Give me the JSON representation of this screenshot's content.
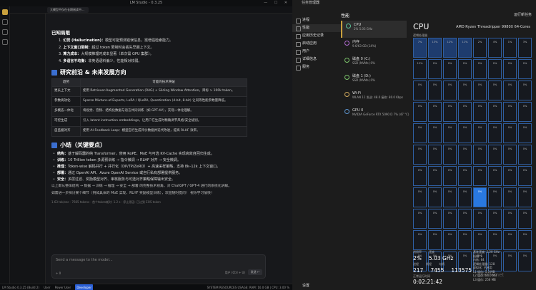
{
  "lm": {
    "title": "LM Studio - 0.3.25",
    "window_controls": "— ☐ ✕",
    "tab": "大模型不仅在长期阅读中...",
    "h_limits": "已知局限",
    "limits": [
      {
        "label": "幻觉 (Hallucination)：",
        "text": "模型可能预测错误信息，需增强检索能力。"
      },
      {
        "label": "上下文窗口限制：",
        "text": "超过 token 限制时会丢失早期上下文。"
      },
      {
        "label": "算力成本：",
        "text": "大规模推理时成本显著（单次需 GPU 集群）。"
      },
      {
        "label": "多语言不均衡：",
        "text": "非英语语料偏少，性能相对较弱。"
      }
    ],
    "h_research": "研究前沿 & 未来发展方向",
    "table_headers": [
      "趋势",
      "可能的技术突破"
    ],
    "table_rows": [
      {
        "k": "更长上下文",
        "v": "使用 Retriever-Augmented Generation (RAG) + Sliding Window Attention，目标 > 100k token。"
      },
      {
        "k": "参数高效化",
        "v": "Sparse Mixture-of-Experts, LoRA / QLoRA, Quantization (4-bit, 8-bit) 让同等性能参数量降低。"
      },
      {
        "k": "多模态一体化",
        "v": "将视觉、音频、结构化数据与语言共同训练（如 GPT-4V），实现一体化理解。"
      },
      {
        "k": "可控生成",
        "v": "引入 latent instruction embeddings，让用户在生成时精确调节风格/安全级别。"
      },
      {
        "k": "自监督对齐",
        "v": "使用 AI-Feedback Loop：模型自行生成评价数据并迭代改进，提高 RLHF 效率。"
      }
    ],
    "h_summary": "小结（关键要点）",
    "summary": [
      {
        "label": "结构：",
        "text": "基于解码器的纯 Transformer，使用 RoPE、MoE 与可选 KV-Cache 实现高效自回归生成。"
      },
      {
        "label": "训练：",
        "text": "10 Trillion token 多源预训练 → 指令微调 → RLHF 对齐 → 安全微调。"
      },
      {
        "label": "推理：",
        "text": "Token-wise 解码并行 + 并行化（DP/TP/ZeRO）+ 高速采样策略，支持 8k–12k 上下文窗口。"
      },
      {
        "label": "部署：",
        "text": "通过 OpenAI API、Azure OpenAI Service 或自行私有部署提供服务。"
      },
      {
        "label": "安全：",
        "text": "多层过滤、奖励模型对齐、审核服务与可选对齐策略保障输出安全。"
      }
    ],
    "note1": "以上即从整体结构 → 数据 → 训练 → 推理 → 安全 → 部署 的完整技术视角，对 ChatGPT / GPT-4 进行的系统化讲解。",
    "note2": "如需进一步探讨某个细节（例如具体的 MoE 实现、RLHF 奖励模型训练），欢迎随时提问！ 祝你学习愉快！",
    "stats": "1.63 tok/sec · 7665 tokens · 首个token耗时: 1.2 s · 停止原因: 已达到 EOS token",
    "input_placeholder": "Send a message to the model...",
    "input_count": "+ 0",
    "user_label": "用户 (Ctrl + U)",
    "send_label": "发送 ↵",
    "status": [
      "LM Studio 0.3.25 (Build 2)",
      "User",
      "Power User",
      "Developer",
      "SYSTEM RESOURCES USAGE: RAM: 16.0 GB | CPU: 3.00 %"
    ]
  },
  "tm": {
    "title": "任务管理器",
    "nav": [
      "进程",
      "性能",
      "应用历史记录",
      "启动应用",
      "用户",
      "详细信息",
      "服务"
    ],
    "header": "性能",
    "run_task": "运行新任务",
    "devices": [
      {
        "name": "CPU",
        "sub": "2%  5.03 GHz",
        "color": "#5cc49a"
      },
      {
        "name": "内存",
        "sub": "9.6/63 GB (14%)",
        "color": "#b06ad0"
      },
      {
        "name": "磁盘 0 (C:)",
        "sub": "SSD (NVMe)\n0%",
        "color": "#7cc36b"
      },
      {
        "name": "磁盘 1 (D:)",
        "sub": "SSD (NVMe)\n0%",
        "color": "#7cc36b"
      },
      {
        "name": "Wi-Fi",
        "sub": "WLAN 11\n发送: 48.0 接收: 80.0 Kbps",
        "color": "#d0a85c"
      },
      {
        "name": "GPU 0",
        "sub": "NVIDIA GeForce RTX 5090 D\n7% (47 °C)",
        "color": "#5c95d0"
      }
    ],
    "cpu_title": "CPU",
    "cpu_model": "AMD Ryzen Threadripper 9980X 64-Cores",
    "cpu_sub": "逻辑处理器",
    "cores": [
      "7%",
      "13%",
      "12%",
      "11%",
      "2%",
      "4%",
      "1%",
      "3%",
      "12%",
      "0%",
      "0%",
      "0%",
      "0%",
      "0%",
      "0%",
      "0%",
      "0%",
      "0%",
      "0%",
      "0%",
      "0%",
      "0%",
      "0%",
      "0%",
      "0%",
      "0%",
      "0%",
      "0%",
      "0%",
      "0%",
      "0%",
      "0%",
      "0%",
      "0%",
      "0%",
      "0%",
      "0%",
      "0%",
      "0%",
      "0%",
      "0%",
      "0%",
      "0%",
      "0%",
      "0%",
      "0%",
      "0%",
      "0%",
      "0%",
      "0%",
      "0%",
      "0%",
      "0%",
      "0%",
      "0%",
      "0%",
      "0%",
      "0%",
      "0%",
      "0%",
      "0%",
      "0%",
      "0%",
      "0%",
      "0%",
      "0%",
      "0%",
      "0%",
      "0%",
      "0%",
      "0%",
      "0%",
      "0%",
      "0%",
      "0%",
      "0%",
      "0%",
      "0%",
      "0%",
      "0%",
      "0%",
      "0%",
      "0%",
      "0%",
      "0%",
      "0%",
      "0%",
      "0%",
      "0%",
      "0%",
      "0%",
      "0%",
      "0%",
      "0%",
      "0%",
      "0%"
    ],
    "hot_index": 60,
    "stats": {
      "util_label": "利用率",
      "util": "2%",
      "speed_label": "速度",
      "speed": "5.03 GHz",
      "proc_label": "进程",
      "proc": "217",
      "threads_label": "线程",
      "threads": "7455",
      "handles_label": "句柄",
      "handles": "113575",
      "uptime_label": "正常运行时间",
      "uptime": "0:02:21:42",
      "right": [
        "基准速度:  3.20 GHz",
        "插槽:  1",
        "内核:  64",
        "逻辑处理器:  128",
        "虚拟化:  已启用",
        "L1 缓存:  5.0 MB",
        "L2 缓存:  64.0 MB",
        "L3 缓存:  256 MB"
      ]
    },
    "settings": "设置"
  },
  "watermark": "3elife.net"
}
